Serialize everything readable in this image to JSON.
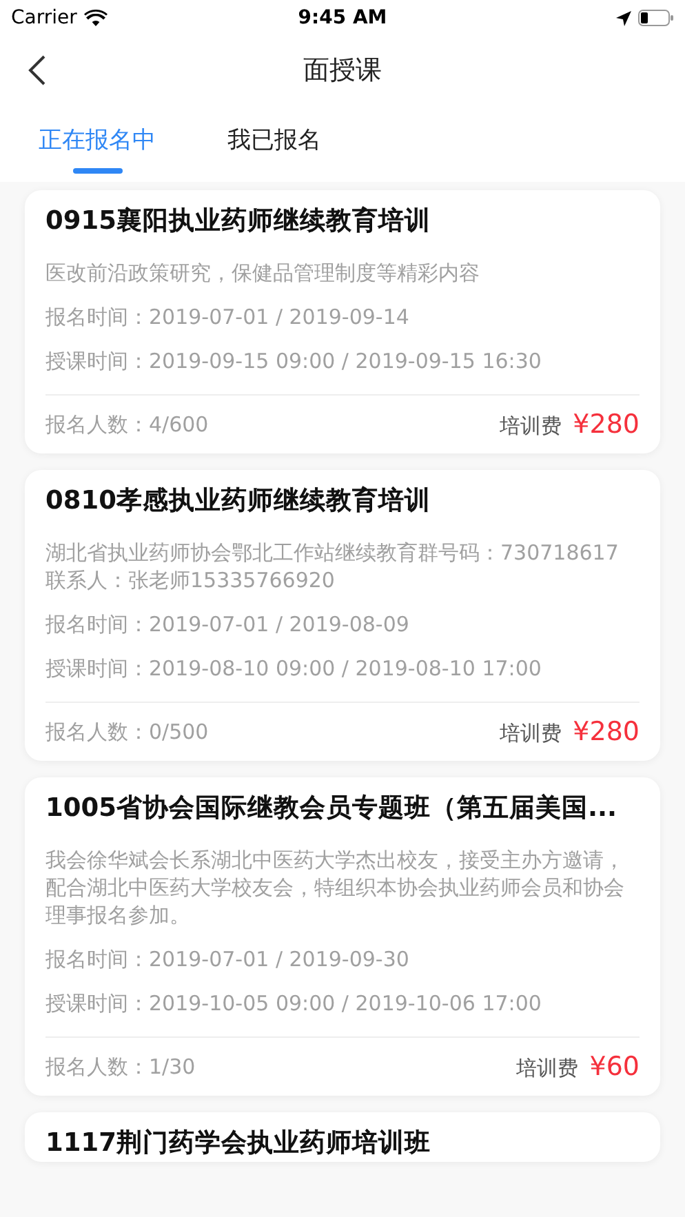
{
  "status_bar": {
    "carrier": "Carrier",
    "time": "9:45 AM"
  },
  "nav": {
    "title": "面授课"
  },
  "tabs": [
    {
      "label": "正在报名中",
      "selected": true
    },
    {
      "label": "我已报名",
      "selected": false
    }
  ],
  "courses": [
    {
      "title": "0915襄阳执业药师继续教育培训",
      "description": "医改前沿政策研究，保健品管理制度等精彩内容",
      "signup_time": "报名时间：2019-07-01 / 2019-09-14",
      "class_time": "授课时间：2019-09-15 09:00 / 2019-09-15 16:30",
      "enrolled": "报名人数：4/600",
      "fee_label": "培训费",
      "price": "¥280"
    },
    {
      "title": "0810孝感执业药师继续教育培训",
      "description": "湖北省执业药师协会鄂北工作站继续教育群号码：730718617　联系人：张老师15335766920",
      "signup_time": "报名时间：2019-07-01 / 2019-08-09",
      "class_time": "授课时间：2019-08-10 09:00 / 2019-08-10 17:00",
      "enrolled": "报名人数：0/500",
      "fee_label": "培训费",
      "price": "¥280"
    },
    {
      "title": "1005省协会国际继教会员专题班（第五届美国...",
      "description": "我会徐华斌会长系湖北中医药大学杰出校友，接受主办方邀请，配合湖北中医药大学校友会，特组织本协会执业药师会员和协会理事报名参加。",
      "signup_time": "报名时间：2019-07-01 / 2019-09-30",
      "class_time": "授课时间：2019-10-05 09:00 / 2019-10-06 17:00",
      "enrolled": "报名人数：1/30",
      "fee_label": "培训费",
      "price": "¥60"
    },
    {
      "title": "1117荆门药学会执业药师培训班"
    }
  ]
}
